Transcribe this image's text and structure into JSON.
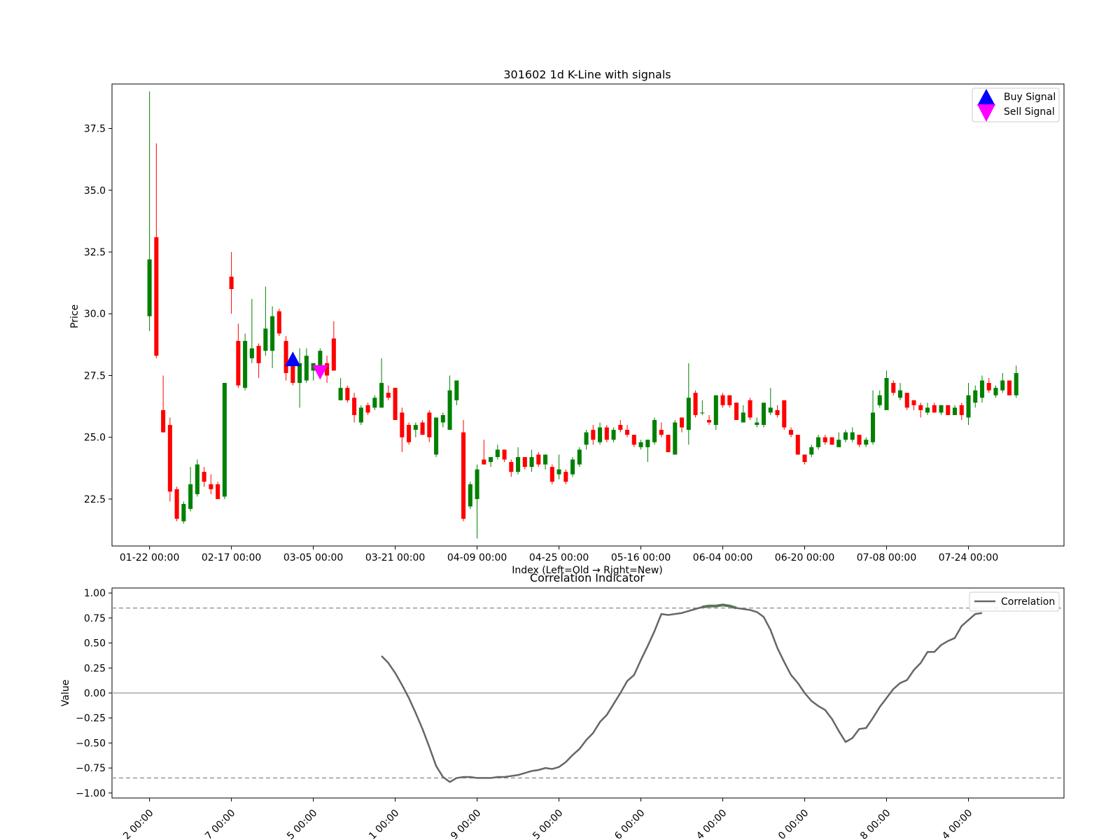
{
  "colors": {
    "up": "#008000",
    "down": "#ff0000",
    "buy": "#0000ff",
    "sell": "#ff00ff",
    "correlation": "#666666",
    "threshold": "#999999",
    "zero": "#aaaaaa",
    "highlight": "#4a9a4a"
  },
  "chart_data": [
    {
      "type": "candlestick",
      "title": "301602 1d K-Line with signals",
      "xlabel": "Index (Left=Old → Right=New)",
      "ylabel": "Price",
      "ylim": [
        20.6,
        39.3
      ],
      "xlim": [
        -5.5,
        134.0
      ],
      "yticks": [
        22.5,
        25.0,
        27.5,
        30.0,
        32.5,
        35.0,
        37.5
      ],
      "ytick_labels": [
        "22.5",
        "25.0",
        "27.5",
        "30.0",
        "32.5",
        "35.0",
        "37.5"
      ],
      "xticks": [
        0,
        12,
        24,
        36,
        48,
        60,
        72,
        84,
        96,
        108,
        120
      ],
      "xtick_labels": [
        "01-22 00:00",
        "02-17 00:00",
        "03-05 00:00",
        "03-21 00:00",
        "04-09 00:00",
        "04-25 00:00",
        "05-16 00:00",
        "06-04 00:00",
        "06-20 00:00",
        "07-08 00:00",
        "07-24 00:00"
      ],
      "legend": {
        "position": "top-right",
        "entries": [
          "Buy Signal",
          "Sell Signal"
        ]
      },
      "ohlc": [
        [
          29.9,
          39.0,
          29.3,
          32.2
        ],
        [
          33.1,
          36.9,
          28.2,
          28.3
        ],
        [
          26.1,
          27.5,
          25.2,
          25.2
        ],
        [
          25.5,
          25.8,
          22.4,
          22.8
        ],
        [
          22.9,
          23.0,
          21.6,
          21.7
        ],
        [
          21.6,
          22.4,
          21.5,
          22.3
        ],
        [
          22.1,
          23.8,
          22.0,
          23.1
        ],
        [
          22.7,
          24.1,
          22.6,
          23.9
        ],
        [
          23.6,
          23.8,
          23.0,
          23.2
        ],
        [
          23.1,
          23.5,
          22.7,
          22.9
        ],
        [
          23.1,
          23.2,
          22.5,
          22.5
        ],
        [
          22.6,
          27.2,
          22.5,
          27.2
        ],
        [
          31.5,
          32.5,
          30.0,
          31.0
        ],
        [
          28.9,
          29.6,
          27.0,
          27.1
        ],
        [
          27.0,
          29.2,
          26.9,
          28.9
        ],
        [
          28.2,
          30.6,
          28.0,
          28.6
        ],
        [
          28.7,
          28.8,
          27.4,
          28.0
        ],
        [
          28.5,
          31.1,
          28.3,
          29.4
        ],
        [
          28.5,
          30.3,
          27.8,
          29.9
        ],
        [
          30.1,
          30.2,
          29.1,
          29.2
        ],
        [
          28.9,
          29.1,
          27.3,
          27.6
        ],
        [
          28.0,
          28.3,
          27.1,
          27.2
        ],
        [
          27.2,
          28.6,
          26.2,
          28.0
        ],
        [
          27.3,
          28.6,
          27.2,
          28.3
        ],
        [
          27.7,
          28.0,
          27.3,
          28.0
        ],
        [
          27.9,
          28.6,
          27.4,
          28.5
        ],
        [
          28.0,
          28.3,
          27.2,
          27.5
        ],
        [
          29.0,
          29.7,
          27.7,
          27.7
        ],
        [
          26.5,
          27.4,
          26.5,
          27.0
        ],
        [
          27.0,
          27.1,
          26.4,
          26.5
        ],
        [
          26.6,
          26.8,
          25.6,
          25.9
        ],
        [
          25.6,
          26.3,
          25.5,
          26.2
        ],
        [
          26.3,
          26.4,
          25.9,
          26.0
        ],
        [
          26.2,
          26.7,
          26.1,
          26.6
        ],
        [
          26.2,
          28.2,
          26.2,
          27.2
        ],
        [
          26.8,
          27.1,
          26.5,
          26.6
        ],
        [
          27.0,
          27.0,
          25.7,
          25.7
        ],
        [
          26.0,
          26.2,
          24.4,
          25.0
        ],
        [
          25.5,
          25.6,
          24.7,
          24.8
        ],
        [
          25.3,
          25.6,
          25.0,
          25.5
        ],
        [
          25.6,
          25.7,
          25.1,
          25.1
        ],
        [
          26.0,
          26.1,
          24.8,
          25.0
        ],
        [
          24.3,
          25.8,
          24.2,
          25.8
        ],
        [
          25.6,
          26.0,
          25.4,
          25.9
        ],
        [
          25.3,
          27.5,
          25.3,
          26.9
        ],
        [
          26.5,
          27.3,
          26.3,
          27.3
        ],
        [
          25.2,
          25.7,
          21.6,
          21.7
        ],
        [
          22.2,
          23.2,
          22.1,
          23.1
        ],
        [
          22.5,
          23.9,
          20.9,
          23.7
        ],
        [
          24.1,
          24.9,
          23.9,
          23.9
        ],
        [
          24.0,
          24.2,
          23.8,
          24.2
        ],
        [
          24.2,
          24.7,
          24.1,
          24.5
        ],
        [
          24.5,
          24.5,
          24.0,
          24.1
        ],
        [
          24.0,
          24.1,
          23.4,
          23.6
        ],
        [
          23.6,
          24.6,
          23.5,
          24.2
        ],
        [
          24.2,
          24.2,
          23.7,
          23.8
        ],
        [
          23.8,
          24.5,
          23.6,
          24.2
        ],
        [
          24.3,
          24.4,
          23.8,
          23.9
        ],
        [
          23.9,
          24.3,
          23.7,
          24.3
        ],
        [
          23.8,
          23.9,
          23.1,
          23.2
        ],
        [
          23.5,
          24.3,
          23.3,
          23.7
        ],
        [
          23.6,
          23.7,
          23.1,
          23.2
        ],
        [
          23.5,
          24.2,
          23.4,
          24.1
        ],
        [
          23.9,
          24.6,
          23.8,
          24.5
        ],
        [
          24.7,
          25.3,
          24.5,
          25.2
        ],
        [
          25.3,
          25.5,
          24.7,
          24.9
        ],
        [
          24.8,
          25.6,
          24.7,
          25.4
        ],
        [
          25.4,
          25.5,
          24.8,
          24.9
        ],
        [
          24.9,
          25.4,
          24.8,
          25.3
        ],
        [
          25.5,
          25.7,
          25.2,
          25.3
        ],
        [
          25.3,
          25.5,
          25.0,
          25.1
        ],
        [
          25.1,
          25.1,
          24.6,
          24.7
        ],
        [
          24.6,
          24.9,
          24.5,
          24.8
        ],
        [
          24.6,
          24.9,
          24.0,
          24.9
        ],
        [
          24.8,
          25.8,
          24.7,
          25.7
        ],
        [
          25.3,
          25.6,
          25.0,
          25.1
        ],
        [
          25.1,
          25.1,
          24.4,
          24.4
        ],
        [
          24.3,
          25.7,
          24.3,
          25.6
        ],
        [
          25.8,
          25.8,
          25.2,
          25.4
        ],
        [
          25.3,
          28.0,
          24.7,
          26.6
        ],
        [
          26.8,
          26.9,
          25.8,
          25.9
        ],
        [
          26.0,
          26.5,
          25.9,
          26.0
        ],
        [
          25.7,
          25.9,
          25.5,
          25.6
        ],
        [
          25.5,
          26.7,
          25.3,
          26.7
        ],
        [
          26.7,
          26.8,
          26.2,
          26.3
        ],
        [
          26.7,
          26.7,
          26.2,
          26.3
        ],
        [
          26.4,
          26.4,
          25.7,
          25.7
        ],
        [
          25.6,
          26.3,
          25.6,
          26.0
        ],
        [
          26.5,
          26.6,
          25.7,
          25.8
        ],
        [
          25.5,
          25.8,
          25.4,
          25.6
        ],
        [
          25.5,
          26.4,
          25.4,
          26.4
        ],
        [
          26.0,
          27.0,
          25.9,
          26.2
        ],
        [
          26.1,
          26.3,
          25.8,
          25.9
        ],
        [
          26.5,
          26.5,
          25.3,
          25.4
        ],
        [
          25.3,
          25.4,
          25.0,
          25.1
        ],
        [
          25.1,
          25.1,
          24.3,
          24.3
        ],
        [
          24.3,
          24.3,
          23.9,
          24.0
        ],
        [
          24.3,
          24.7,
          24.2,
          24.6
        ],
        [
          24.6,
          25.1,
          24.5,
          25.0
        ],
        [
          25.0,
          25.1,
          24.7,
          24.8
        ],
        [
          25.0,
          25.0,
          24.7,
          24.7
        ],
        [
          24.6,
          25.2,
          24.6,
          24.9
        ],
        [
          24.9,
          25.3,
          24.8,
          25.2
        ],
        [
          24.9,
          25.4,
          24.8,
          25.2
        ],
        [
          25.1,
          25.1,
          24.6,
          24.7
        ],
        [
          24.7,
          25.0,
          24.6,
          24.9
        ],
        [
          24.8,
          26.9,
          24.7,
          26.0
        ],
        [
          26.3,
          26.9,
          26.2,
          26.7
        ],
        [
          26.1,
          27.7,
          26.1,
          27.4
        ],
        [
          27.2,
          27.3,
          26.7,
          26.8
        ],
        [
          26.6,
          27.2,
          26.5,
          26.9
        ],
        [
          26.8,
          26.8,
          26.1,
          26.2
        ],
        [
          26.5,
          26.5,
          26.1,
          26.3
        ],
        [
          26.3,
          26.4,
          25.8,
          26.1
        ],
        [
          26.0,
          26.4,
          25.9,
          26.2
        ],
        [
          26.3,
          26.4,
          26.0,
          26.0
        ],
        [
          26.0,
          26.3,
          25.9,
          26.3
        ],
        [
          26.3,
          26.3,
          25.9,
          25.9
        ],
        [
          25.9,
          26.3,
          25.9,
          26.2
        ],
        [
          26.3,
          26.4,
          25.7,
          25.9
        ],
        [
          25.8,
          27.2,
          25.5,
          26.7
        ],
        [
          26.4,
          27.1,
          26.2,
          26.9
        ],
        [
          26.6,
          27.5,
          26.4,
          27.3
        ],
        [
          27.2,
          27.4,
          26.8,
          26.9
        ],
        [
          26.7,
          27.1,
          26.6,
          27.0
        ],
        [
          26.9,
          27.6,
          26.8,
          27.3
        ],
        [
          27.3,
          27.3,
          26.7,
          26.7
        ],
        [
          26.7,
          27.9,
          26.6,
          27.6
        ]
      ],
      "signals": [
        {
          "type": "buy",
          "name": "Buy Signal",
          "x": 21,
          "y": 28.1
        },
        {
          "type": "sell",
          "name": "Sell Signal",
          "x": 25,
          "y": 27.7
        }
      ]
    },
    {
      "type": "line",
      "title": "Correlation Indicator",
      "ylabel": "Value",
      "ylim": [
        -1.05,
        1.05
      ],
      "xlim": [
        -5.5,
        134.0
      ],
      "yticks": [
        -1.0,
        -0.75,
        -0.5,
        -0.25,
        0.0,
        0.25,
        0.5,
        0.75,
        1.0
      ],
      "ytick_labels": [
        "−1.00",
        "−0.75",
        "−0.50",
        "−0.25",
        "0.00",
        "0.25",
        "0.50",
        "0.75",
        "1.00"
      ],
      "xticks": [
        0,
        12,
        24,
        36,
        48,
        60,
        72,
        84,
        96,
        108,
        120
      ],
      "xtick_labels": [
        "…2 00:00",
        "…7 00:00",
        "…5 00:00",
        "…1 00:00",
        "…9 00:00",
        "…5 00:00",
        "…6 00:00",
        "…4 00:00",
        "…0 00:00",
        "…8 00:00",
        "…4 00:00"
      ],
      "thresholds": [
        0.85,
        -0.85
      ],
      "legend": {
        "position": "top-right",
        "entries": [
          "Correlation"
        ]
      },
      "series": [
        {
          "name": "Correlation",
          "x_start": 34,
          "values": [
            0.37,
            0.3,
            0.2,
            0.08,
            -0.05,
            -0.2,
            -0.36,
            -0.54,
            -0.73,
            -0.84,
            -0.89,
            -0.85,
            -0.84,
            -0.84,
            -0.85,
            -0.85,
            -0.85,
            -0.84,
            -0.84,
            -0.83,
            -0.82,
            -0.8,
            -0.78,
            -0.77,
            -0.75,
            -0.76,
            -0.74,
            -0.69,
            -0.62,
            -0.56,
            -0.47,
            -0.4,
            -0.29,
            -0.22,
            -0.11,
            0.0,
            0.12,
            0.18,
            0.33,
            0.47,
            0.62,
            0.79,
            0.78,
            0.79,
            0.8,
            0.82,
            0.84,
            0.86,
            0.87,
            0.87,
            0.88,
            0.87,
            0.85,
            0.84,
            0.83,
            0.81,
            0.76,
            0.63,
            0.45,
            0.31,
            0.18,
            0.1,
            0.0,
            -0.08,
            -0.13,
            -0.17,
            -0.26,
            -0.38,
            -0.49,
            -0.45,
            -0.36,
            -0.35,
            -0.25,
            -0.14,
            -0.05,
            0.04,
            0.1,
            0.13,
            0.23,
            0.3,
            0.41,
            0.41,
            0.48,
            0.52,
            0.55,
            0.67,
            0.73,
            0.79,
            0.8
          ]
        }
      ]
    }
  ]
}
